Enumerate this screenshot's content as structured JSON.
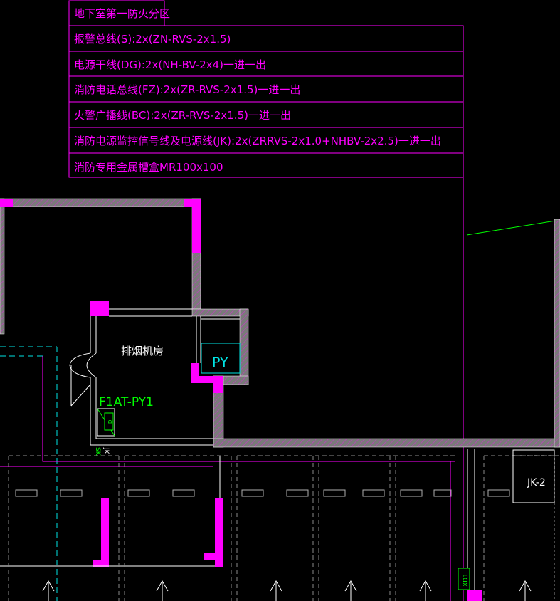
{
  "legend": {
    "title": "地下室第一防火分区",
    "rows": [
      "报警总线(S):2x(ZN-RVS-2x1.5)",
      "电源干线(DG):2x(NH-BV-2x4)一进一出",
      "消防电话总线(FZ):2x(ZR-RVS-2x1.5)一进一出",
      "火警广播线(BC):2x(ZR-RVS-2x1.5)一进一出",
      "消防电源监控信号线及电源线(JK):2x(ZRRVS-2x1.0+NHBV-2x2.5)一进一出",
      "消防专用金属槽盒MR100x100"
    ]
  },
  "labels": {
    "room": "排烟机房",
    "shaft": "PY",
    "panel": "F1AT-PY1",
    "box": "JK-2",
    "tag_small": "JK",
    "tag_sk": "SK",
    "meter": "DH",
    "xd": "XD1"
  },
  "colors": {
    "magenta": "#ff00ff",
    "green": "#00ff00",
    "cyan": "#00e5e5",
    "white": "#ffffff",
    "wall_fill": "#808080",
    "hatch": "#b040b0"
  }
}
